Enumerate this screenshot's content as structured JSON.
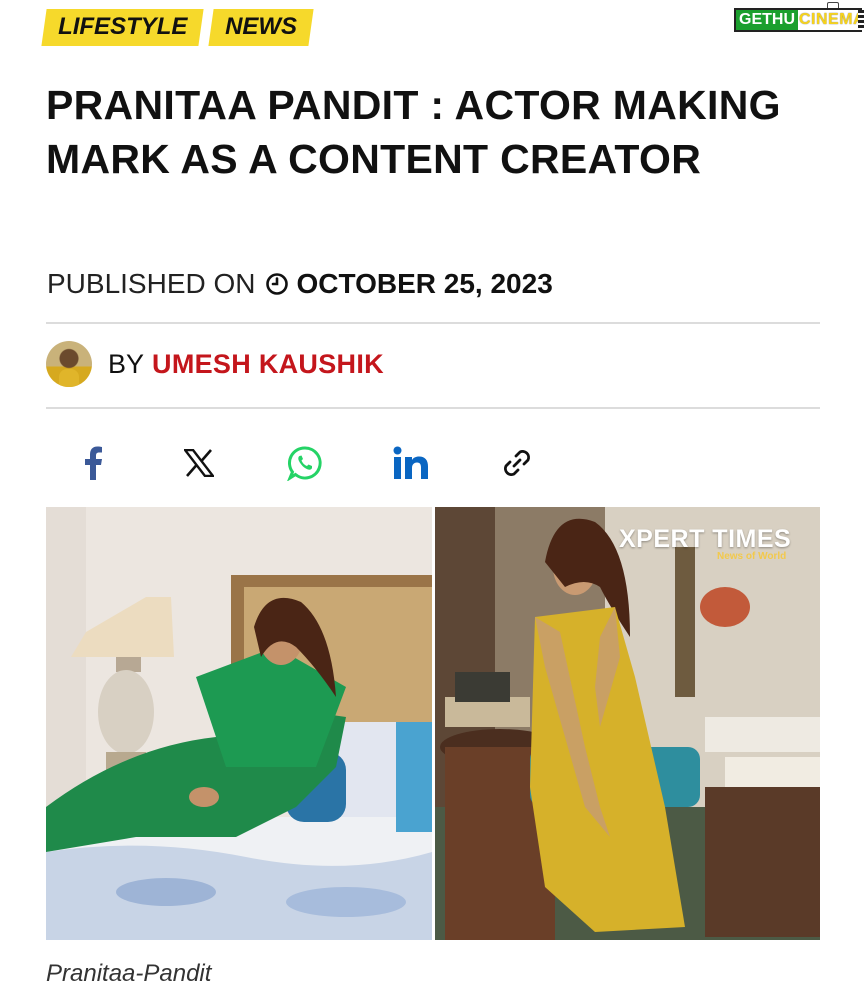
{
  "tags": [
    "LIFESTYLE",
    "NEWS"
  ],
  "logo": {
    "part1": "GETHU",
    "part2": "CINEMA"
  },
  "headline": "PRANITAA PANDIT : ACTOR MAKING MARK AS A CONTENT CREATOR",
  "published": {
    "label": "PUBLISHED ON",
    "date": "OCTOBER 25, 2023",
    "icon": "clock-icon"
  },
  "author": {
    "by": "BY",
    "name": "UMESH KAUSHIK"
  },
  "share": [
    "facebook-icon",
    "x-icon",
    "whatsapp-icon",
    "linkedin-icon",
    "link-icon"
  ],
  "image": {
    "magazine_title": "XPERT TIMES",
    "magazine_subtitle": "News of World"
  },
  "caption": "Pranitaa-Pandit",
  "colors": {
    "tag": "#f6d92b",
    "author": "#c4161c",
    "facebook": "#3b5998",
    "whatsapp": "#25d366",
    "linkedin": "#0a66c2"
  }
}
